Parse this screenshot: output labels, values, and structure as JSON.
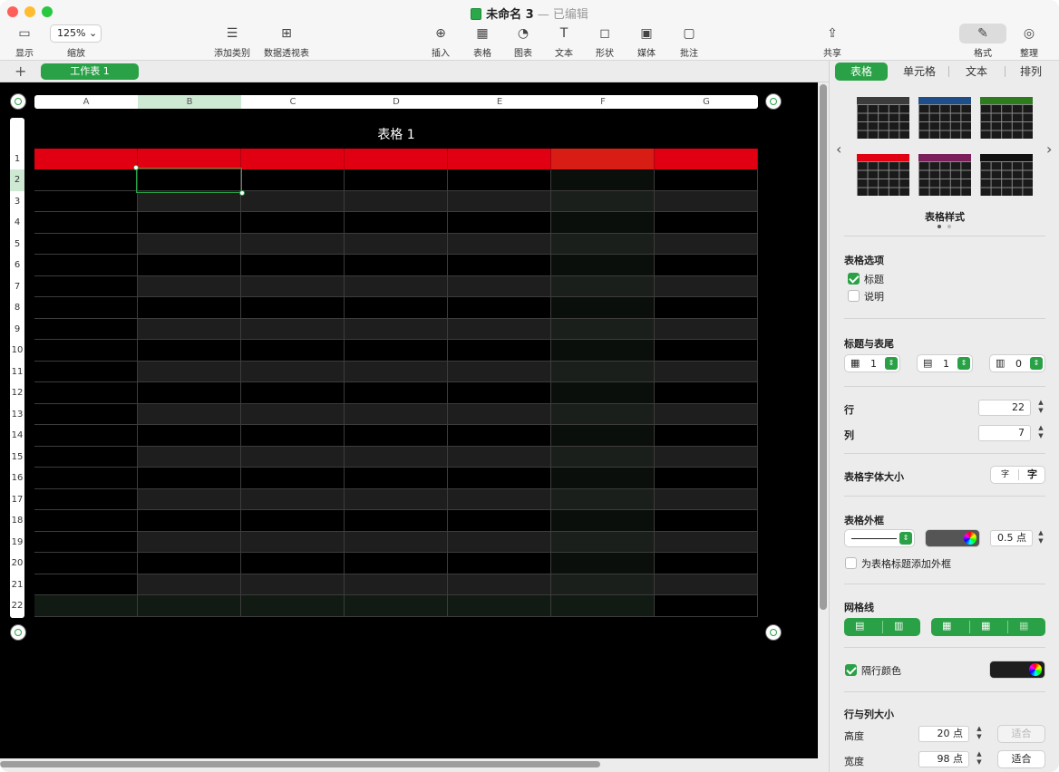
{
  "window": {
    "title": "未命名 3",
    "status": "— 已编辑"
  },
  "toolbar": {
    "view": "显示",
    "zoom_value": "125%",
    "zoom_label": "缩放",
    "add_category": "添加类别",
    "pivot_table": "数据透视表",
    "insert": "插入",
    "table": "表格",
    "chart": "图表",
    "text": "文本",
    "shape": "形状",
    "media": "媒体",
    "comment": "批注",
    "share": "共享",
    "format": "格式",
    "organize": "整理"
  },
  "sheet_tabs": {
    "add": "+",
    "active": "工作表 1"
  },
  "spreadsheet": {
    "table_title": "表格 1",
    "columns": [
      "A",
      "B",
      "C",
      "D",
      "E",
      "F",
      "G"
    ],
    "rows": [
      "1",
      "2",
      "3",
      "4",
      "5",
      "6",
      "7",
      "8",
      "9",
      "10",
      "11",
      "12",
      "13",
      "14",
      "15",
      "16",
      "17",
      "18",
      "19",
      "20",
      "21",
      "22"
    ],
    "selected_cell": "B2",
    "header_color": "#e00012"
  },
  "panel": {
    "tabs": [
      "表格",
      "单元格",
      "文本",
      "排列"
    ],
    "active_tab": "表格",
    "table_styles_label": "表格样式",
    "style_header_colors": [
      "#3c3c3c",
      "#1f4f8a",
      "#2d7d1f",
      "#e00012",
      "#7b1f5a",
      "#111111"
    ],
    "table_options_label": "表格选项",
    "opt_title": "标题",
    "opt_caption": "说明",
    "headers_footers_label": "标题与表尾",
    "header_rows": "1",
    "header_cols": "1",
    "footer_rows": "0",
    "rows_label": "行",
    "rows_value": "22",
    "cols_label": "列",
    "cols_value": "7",
    "font_size_label": "表格字体大小",
    "font_small": "字",
    "font_large": "字",
    "outline_label": "表格外框",
    "outline_width": "0.5 点",
    "outline_title_border": "为表格标题添加外框",
    "gridlines_label": "网格线",
    "alt_row_label": "隔行颜色",
    "row_col_size_label": "行与列大小",
    "height_label": "高度",
    "height_value": "20 点",
    "width_label": "宽度",
    "width_value": "98 点",
    "fit": "适合"
  }
}
